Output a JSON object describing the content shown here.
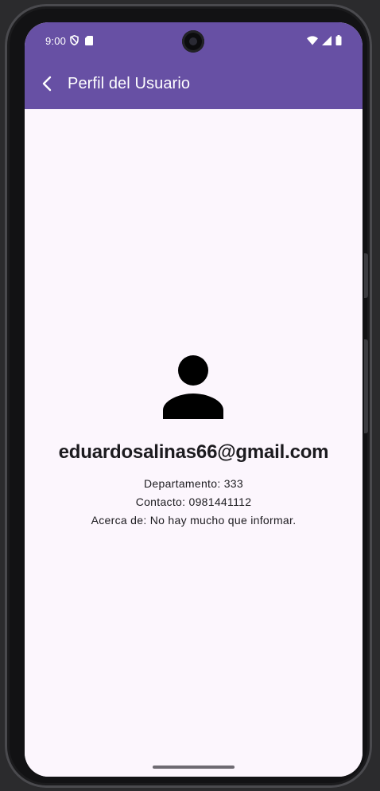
{
  "status_bar": {
    "time": "9:00",
    "left_icons": [
      "shield-icon",
      "sd-card-icon"
    ],
    "right_icons": [
      "wifi-icon",
      "cellular-signal-icon",
      "battery-icon"
    ]
  },
  "app_bar": {
    "title": "Perfil del Usuario",
    "back_icon": "chevron-left-icon"
  },
  "profile": {
    "avatar_icon": "person-icon",
    "email": "eduardosalinas66@gmail.com",
    "department": "Departamento: 333",
    "contact": "Contacto: 0981441112",
    "about": "Acerca de: No hay mucho que informar."
  },
  "colors": {
    "primary": "#6750a4",
    "background": "#fcf6fd",
    "on_primary": "#ffffff",
    "text": "#1c1b1f"
  }
}
